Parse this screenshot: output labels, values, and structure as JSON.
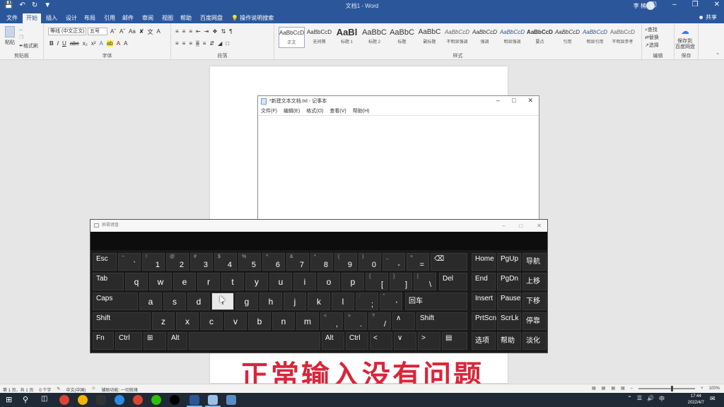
{
  "word": {
    "doc_title": "文档1 - Word",
    "user": "李 楠",
    "tabs": [
      "文件",
      "开始",
      "插入",
      "设计",
      "布局",
      "引用",
      "邮件",
      "审阅",
      "视图",
      "帮助",
      "百度网盘"
    ],
    "tell_me": "操作说明搜索",
    "share": "共享",
    "clipboard": {
      "paste": "粘贴",
      "format_painter": "格式刷",
      "label": "剪贴板"
    },
    "font": {
      "name": "等线 (中文正文)",
      "size": "五号",
      "label": "字体"
    },
    "paragraph_label": "段落",
    "styles_label": "样式",
    "styles": [
      {
        "preview": "AaBbCcD",
        "name": "正文"
      },
      {
        "preview": "AaBbCcD",
        "name": "无间隔"
      },
      {
        "preview": "AaBl",
        "name": "标题 1"
      },
      {
        "preview": "AaBbC",
        "name": "标题 2"
      },
      {
        "preview": "AaBbC",
        "name": "标题"
      },
      {
        "preview": "AaBbC",
        "name": "副标题"
      },
      {
        "preview": "AaBbCcD",
        "name": "不明显强调"
      },
      {
        "preview": "AaBbCcD",
        "name": "强调"
      },
      {
        "preview": "AaBbCcD",
        "name": "明显强调"
      },
      {
        "preview": "AaBbCcD",
        "name": "要点"
      },
      {
        "preview": "AaBbCcD",
        "name": "引用"
      },
      {
        "preview": "AaBbCcD",
        "name": "明显引用"
      },
      {
        "preview": "AaBbCcD",
        "name": "不明显参考"
      }
    ],
    "editing": {
      "find": "查找",
      "replace": "替换",
      "select": "选择",
      "label": "编辑"
    },
    "save": {
      "line1": "保存到",
      "line2": "百度网盘",
      "label": "保存"
    },
    "status": {
      "page": "第 1 页，共 1 页",
      "words": "0 个字",
      "lang": "中文(中国)",
      "accessibility": "辅助功能: 一切就绪",
      "zoom": "100%"
    }
  },
  "notepad": {
    "title": "*新建文本文档.txt - 记事本",
    "menu": [
      "文件(F)",
      "编辑(E)",
      "格式(O)",
      "查看(V)",
      "帮助(H)"
    ]
  },
  "osk": {
    "title": "屏幕键盘",
    "keys": [
      {
        "lbl": "Esc"
      },
      {
        "top": "~",
        "bot": "`"
      },
      {
        "top": "!",
        "bot": "1"
      },
      {
        "top": "@",
        "bot": "2"
      },
      {
        "top": "#",
        "bot": "3"
      },
      {
        "top": "$",
        "bot": "4"
      },
      {
        "top": "%",
        "bot": "5"
      },
      {
        "top": "^",
        "bot": "6"
      },
      {
        "top": "&",
        "bot": "7"
      },
      {
        "top": "*",
        "bot": "8"
      },
      {
        "top": "(",
        "bot": "9"
      },
      {
        "top": ")",
        "bot": "0"
      },
      {
        "top": "_",
        "bot": "-"
      },
      {
        "top": "+",
        "bot": "="
      },
      {
        "lbl": "⌫"
      },
      {
        "lbl": "Home"
      },
      {
        "lbl": "PgUp"
      },
      {
        "lbl": "导航"
      },
      {
        "lbl": "Tab"
      },
      {
        "lbl": "q"
      },
      {
        "lbl": "w"
      },
      {
        "lbl": "e"
      },
      {
        "lbl": "r"
      },
      {
        "lbl": "t"
      },
      {
        "lbl": "y"
      },
      {
        "lbl": "u"
      },
      {
        "lbl": "i"
      },
      {
        "lbl": "o"
      },
      {
        "lbl": "p"
      },
      {
        "top": "{",
        "bot": "["
      },
      {
        "top": "}",
        "bot": "]"
      },
      {
        "top": "|",
        "bot": "\\"
      },
      {
        "lbl": "Del"
      },
      {
        "lbl": "End"
      },
      {
        "lbl": "PgDn"
      },
      {
        "lbl": "上移"
      },
      {
        "lbl": "Caps"
      },
      {
        "lbl": "a"
      },
      {
        "lbl": "s"
      },
      {
        "lbl": "d"
      },
      {
        "lbl": "f"
      },
      {
        "lbl": "g"
      },
      {
        "lbl": "h"
      },
      {
        "lbl": "j"
      },
      {
        "lbl": "k"
      },
      {
        "lbl": "l"
      },
      {
        "top": ":",
        "bot": ";"
      },
      {
        "top": "\"",
        "bot": "'"
      },
      {
        "lbl": "回车"
      },
      {
        "lbl": "Insert"
      },
      {
        "lbl": "Pause"
      },
      {
        "lbl": "下移"
      },
      {
        "lbl": "Shift"
      },
      {
        "lbl": "z"
      },
      {
        "lbl": "x"
      },
      {
        "lbl": "c"
      },
      {
        "lbl": "v"
      },
      {
        "lbl": "b"
      },
      {
        "lbl": "n"
      },
      {
        "lbl": "m"
      },
      {
        "top": "<",
        "bot": ","
      },
      {
        "top": ">",
        "bot": "."
      },
      {
        "top": "?",
        "bot": "/"
      },
      {
        "lbl": "∧"
      },
      {
        "lbl": "Shift"
      },
      {
        "lbl": "PrtScn"
      },
      {
        "lbl": "ScrLk"
      },
      {
        "lbl": "停靠"
      },
      {
        "lbl": "Fn"
      },
      {
        "lbl": "Ctrl"
      },
      {
        "lbl": "⊞"
      },
      {
        "lbl": "Alt"
      },
      {
        "lbl": ""
      },
      {
        "lbl": "Alt"
      },
      {
        "lbl": "Ctrl"
      },
      {
        "lbl": "<"
      },
      {
        "lbl": "∨"
      },
      {
        "lbl": ">"
      },
      {
        "lbl": "▤"
      },
      {
        "lbl": "选项"
      },
      {
        "lbl": "帮助"
      },
      {
        "lbl": "淡化"
      }
    ],
    "pressed_key": "f"
  },
  "caption": "正常输入没有问题",
  "taskbar": {
    "time": "17:44",
    "date": "2022/4/7",
    "ime": "中",
    "apps": [
      "start-icon",
      "search-icon",
      "task-view-icon",
      "chrome-icon",
      "chrome-icon",
      "terminal-icon",
      "browser-icon",
      "globe-icon",
      "wechat-icon",
      "qq-icon",
      "word-icon",
      "notepad-icon",
      "settings-icon"
    ]
  }
}
